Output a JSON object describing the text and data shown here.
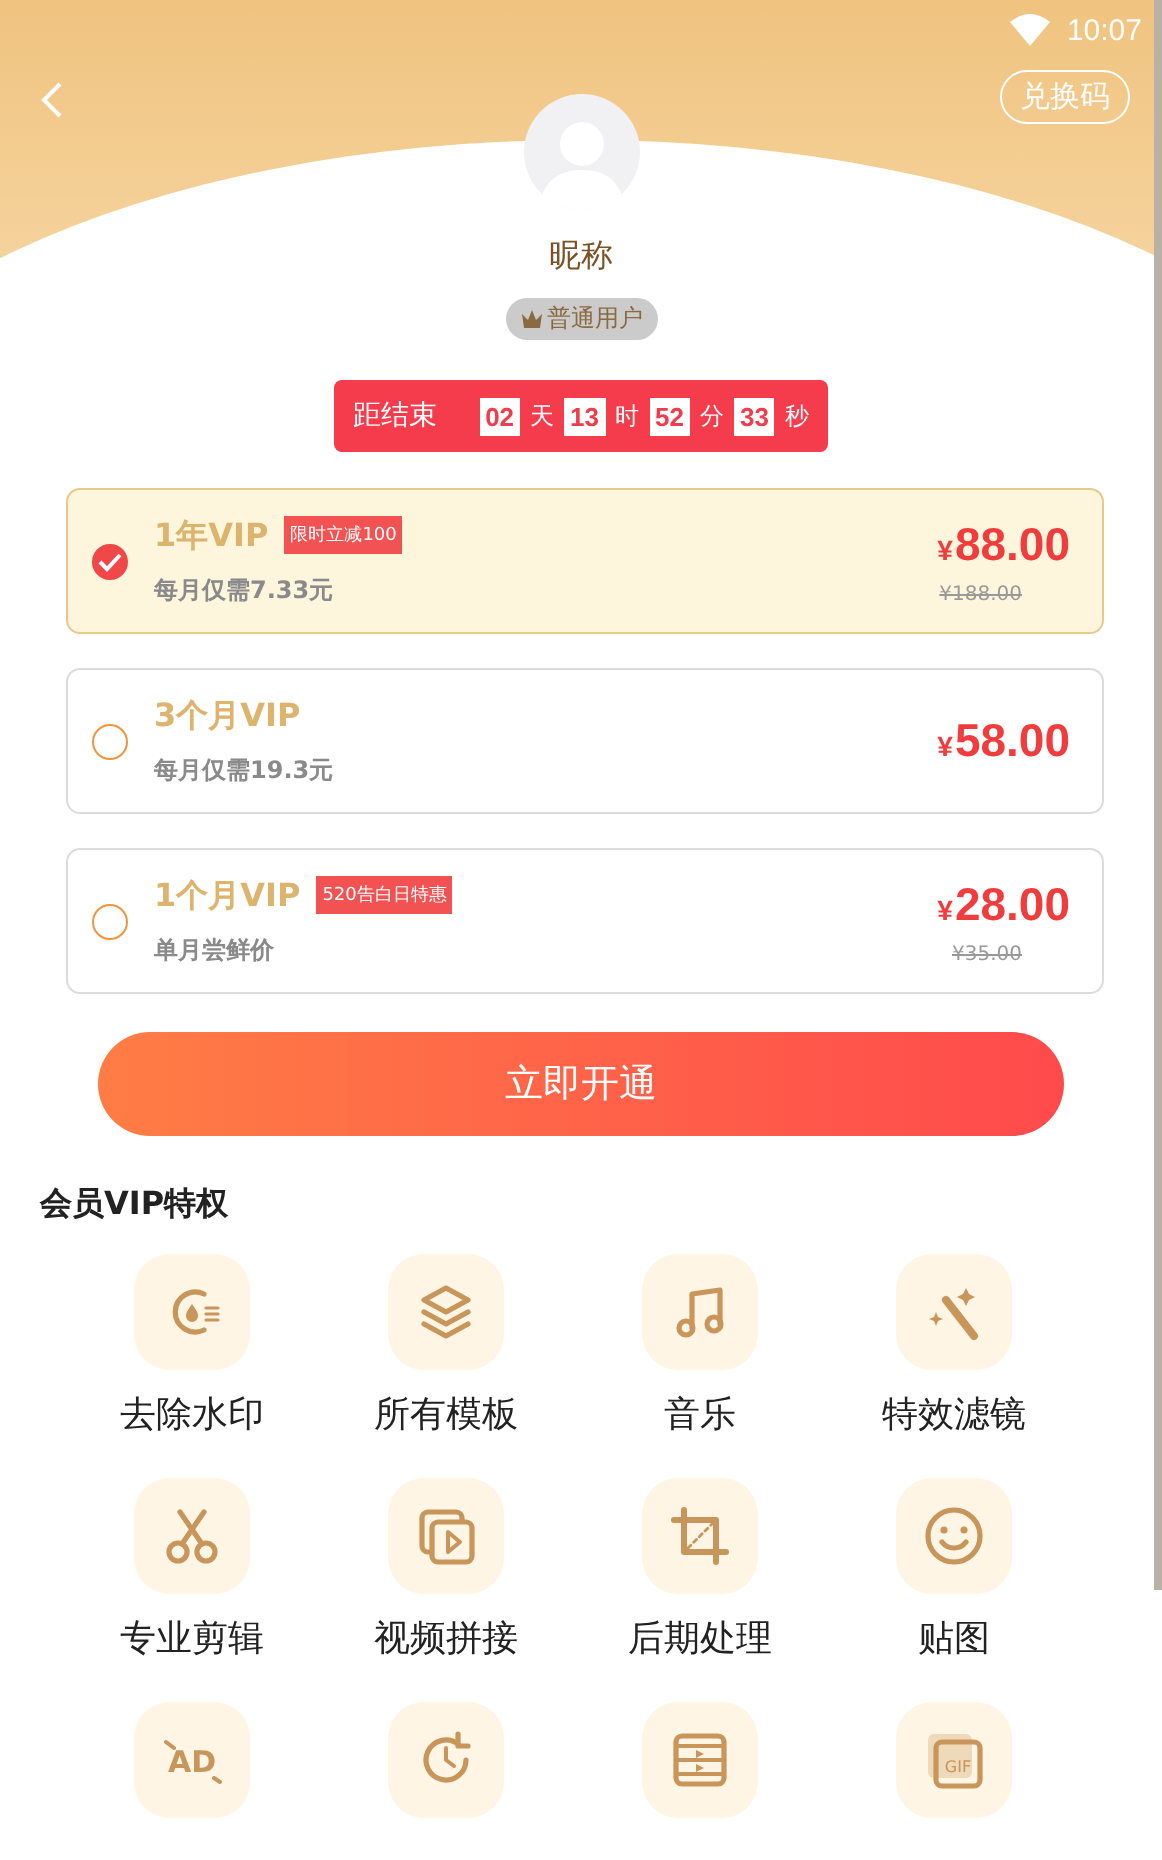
{
  "status_bar": {
    "time": "10:07"
  },
  "header": {
    "redeem_button": "兑换码",
    "nickname": "昵称",
    "user_badge": "普通用户"
  },
  "countdown": {
    "label": "距结束",
    "parts": [
      {
        "value": "02",
        "unit": "天"
      },
      {
        "value": "13",
        "unit": "时"
      },
      {
        "value": "52",
        "unit": "分"
      },
      {
        "value": "33",
        "unit": "秒"
      }
    ]
  },
  "plans": [
    {
      "title": "1年VIP",
      "tag": "限时立减100",
      "subtitle": "每月仅需7.33元",
      "currency": "¥",
      "price": "88.00",
      "original_price": "¥188.00",
      "selected": true
    },
    {
      "title": "3个月VIP",
      "subtitle": "每月仅需19.3元",
      "currency": "¥",
      "price": "58.00",
      "selected": false
    },
    {
      "title": "1个月VIP",
      "tag": "520告白日特惠",
      "subtitle": "单月尝鲜价",
      "currency": "¥",
      "price": "28.00",
      "original_price": "¥35.00",
      "selected": false
    }
  ],
  "open_button": "立即开通",
  "privileges": {
    "title": "会员VIP特权",
    "items": [
      {
        "kind": "labeled",
        "label": "去除水印"
      },
      {
        "kind": "labeled",
        "label": "所有模板"
      },
      {
        "kind": "labeled",
        "label": "音乐"
      },
      {
        "kind": "labeled",
        "label": "特效滤镜"
      },
      {
        "kind": "labeled",
        "label": "专业剪辑"
      },
      {
        "kind": "labeled",
        "label": "视频拼接"
      },
      {
        "kind": "labeled",
        "label": "后期处理"
      },
      {
        "kind": "labeled",
        "label": "贴图"
      },
      {
        "kind": "glyph",
        "glyph": "AD"
      },
      {
        "kind": "plain"
      },
      {
        "kind": "plain"
      },
      {
        "kind": "glyph",
        "glyph": "GIF"
      }
    ]
  }
}
